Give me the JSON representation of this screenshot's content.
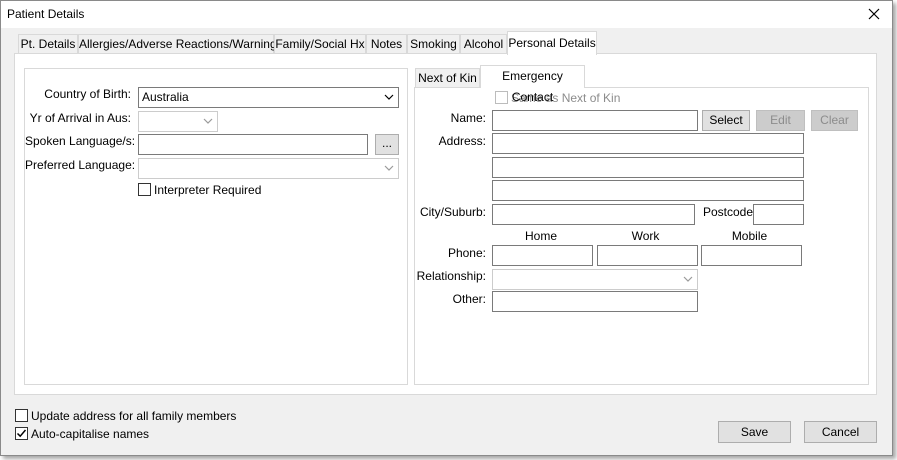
{
  "window": {
    "title": "Patient Details"
  },
  "tabs": [
    {
      "label": "Pt. Details",
      "active": false
    },
    {
      "label": "Allergies/Adverse Reactions/Warnings",
      "active": false
    },
    {
      "label": "Family/Social Hx",
      "active": false
    },
    {
      "label": "Notes",
      "active": false
    },
    {
      "label": "Smoking",
      "active": false
    },
    {
      "label": "Alcohol",
      "active": false
    },
    {
      "label": "Personal Details",
      "active": true
    }
  ],
  "personal": {
    "country_label": "Country of Birth:",
    "country_value": "Australia",
    "yr_label": "Yr of Arrival in Aus:",
    "yr_value": "",
    "spoken_label": "Spoken Language/s:",
    "spoken_value": "",
    "browse_label": "...",
    "preferred_label": "Preferred Language:",
    "preferred_value": "",
    "interpreter_label": "Interpreter Required",
    "interpreter_checked": false
  },
  "contact_tabs": [
    {
      "label": "Next of Kin",
      "active": false
    },
    {
      "label": "Emergency Contact",
      "active": true
    }
  ],
  "emergency": {
    "same_as_label": "Same as Next of Kin",
    "same_as_checked": false,
    "name_label": "Name:",
    "name_value": "",
    "select_label": "Select",
    "edit_label": "Edit",
    "clear_label": "Clear",
    "address_label": "Address:",
    "address_line1": "",
    "address_line2": "",
    "address_line3": "",
    "city_label": "City/Suburb:",
    "city_value": "",
    "postcode_label": "Postcode:",
    "postcode_value": "",
    "home_label": "Home",
    "work_label": "Work",
    "mobile_label": "Mobile",
    "phone_label": "Phone:",
    "phone_home": "",
    "phone_work": "",
    "phone_mobile": "",
    "relationship_label": "Relationship:",
    "relationship_value": "",
    "other_label": "Other:",
    "other_value": ""
  },
  "footer": {
    "update_address_label": "Update address for all family members",
    "update_address_checked": false,
    "auto_cap_label": "Auto-capitalise names",
    "auto_cap_checked": true,
    "save_label": "Save",
    "cancel_label": "Cancel"
  }
}
